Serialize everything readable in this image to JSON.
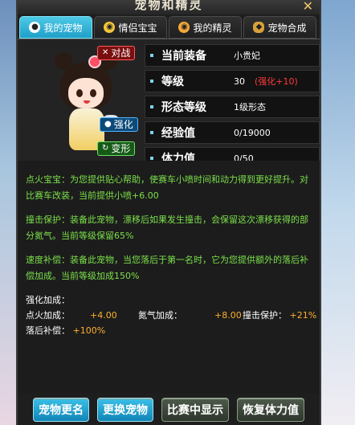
{
  "window": {
    "title": "宠物和精灵",
    "close_glyph": "✕"
  },
  "tabs": [
    {
      "label": "我的宠物",
      "icon": "paw-icon",
      "active": true
    },
    {
      "label": "情侣宝宝",
      "icon": "couple-icon",
      "active": false
    },
    {
      "label": "我的精灵",
      "icon": "sprite-icon",
      "active": false
    },
    {
      "label": "宠物合成",
      "icon": "turtle-icon",
      "active": false
    }
  ],
  "pet": {
    "badges": {
      "duizhan": "对战",
      "qianghua": "强化",
      "bianxing": "变形"
    }
  },
  "stats": [
    {
      "label": "当前装备",
      "value": "小贵妃",
      "extra": ""
    },
    {
      "label": "等级",
      "value": "30",
      "extra": "(强化+10)"
    },
    {
      "label": "形态等级",
      "value": "1级形态",
      "extra": ""
    },
    {
      "label": "经验值",
      "value": "0/19000",
      "extra": ""
    },
    {
      "label": "体力值",
      "value": "0/50",
      "extra": ""
    }
  ],
  "descriptions": [
    {
      "title": "点火宝宝：",
      "text": "为您提供贴心帮助，使赛车小喷时间和动力得到更好提升。对比赛车改装，当前提供小喷+6.00"
    },
    {
      "title": "撞击保护：",
      "text": "装备此宠物，漂移后如果发生撞击，会保留这次漂移获得的部分氮气。当前等级保留65%"
    },
    {
      "title": "速度补偿：",
      "text": "装备此宠物，当您落后于第一名时，它为您提供额外的落后补偿加成。当前等级加成150%"
    }
  ],
  "bonus": {
    "heading": "强化加成：",
    "items": [
      {
        "label": "点火加成：",
        "value": "+4.00"
      },
      {
        "label": "氮气加成：",
        "value": "+8.00"
      },
      {
        "label": "撞击保护：",
        "value": "+21%"
      },
      {
        "label": "落后补偿：",
        "value": "+100%"
      }
    ]
  },
  "buttons": [
    {
      "label": "宠物更名"
    },
    {
      "label": "更换宠物"
    },
    {
      "label": "比赛中显示"
    },
    {
      "label": "恢复体力值"
    }
  ],
  "colors": {
    "accent": "#1fa0c9",
    "desc_text": "#7be04a",
    "highlight": "#ffb02e",
    "warn": "#ff3a3a"
  }
}
